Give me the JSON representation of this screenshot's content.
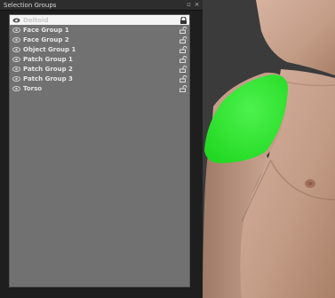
{
  "panel": {
    "title": "Selection Groups",
    "icons": {
      "float": "restore-icon",
      "close": "close-icon"
    }
  },
  "groups": [
    {
      "label": "Deltoid",
      "selected": true,
      "visible": true,
      "locked": true
    },
    {
      "label": "Face Group 1",
      "selected": false,
      "visible": true,
      "locked": false
    },
    {
      "label": "Face Group 2",
      "selected": false,
      "visible": true,
      "locked": false
    },
    {
      "label": "Object Group 1",
      "selected": false,
      "visible": true,
      "locked": false
    },
    {
      "label": "Patch Group 1",
      "selected": false,
      "visible": true,
      "locked": false
    },
    {
      "label": "Patch Group 2",
      "selected": false,
      "visible": true,
      "locked": false
    },
    {
      "label": "Patch Group 3",
      "selected": false,
      "visible": true,
      "locked": false
    },
    {
      "label": "Torso",
      "selected": false,
      "visible": true,
      "locked": false
    }
  ],
  "viewport": {
    "selection_color": "#2ee82e",
    "skin_color": "#c9a48f",
    "background_color": "#3b3b3b"
  }
}
